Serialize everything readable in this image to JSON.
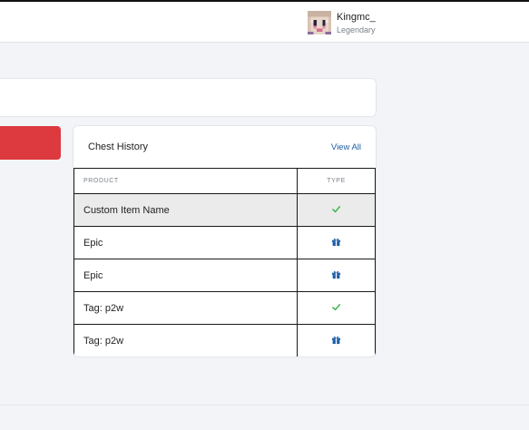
{
  "user": {
    "name": "Kingmc_",
    "rank": "Legendary"
  },
  "chest_history": {
    "title": "Chest History",
    "view_all_label": "View All",
    "columns": [
      "PRODUCT",
      "TYPE"
    ],
    "rows": [
      {
        "product": "Custom Item Name",
        "type_icon": "check-icon",
        "highlighted": true
      },
      {
        "product": "Epic",
        "type_icon": "gift-icon",
        "highlighted": false
      },
      {
        "product": "Epic",
        "type_icon": "gift-icon",
        "highlighted": false
      },
      {
        "product": "Tag: p2w",
        "type_icon": "check-icon",
        "highlighted": false
      },
      {
        "product": "Tag: p2w",
        "type_icon": "gift-icon",
        "highlighted": false
      }
    ]
  },
  "colors": {
    "accent_red": "#dc3a3f",
    "link_blue": "#1d5fa8",
    "check_green": "#3bb54a",
    "gift_blue": "#1d5fa8"
  }
}
